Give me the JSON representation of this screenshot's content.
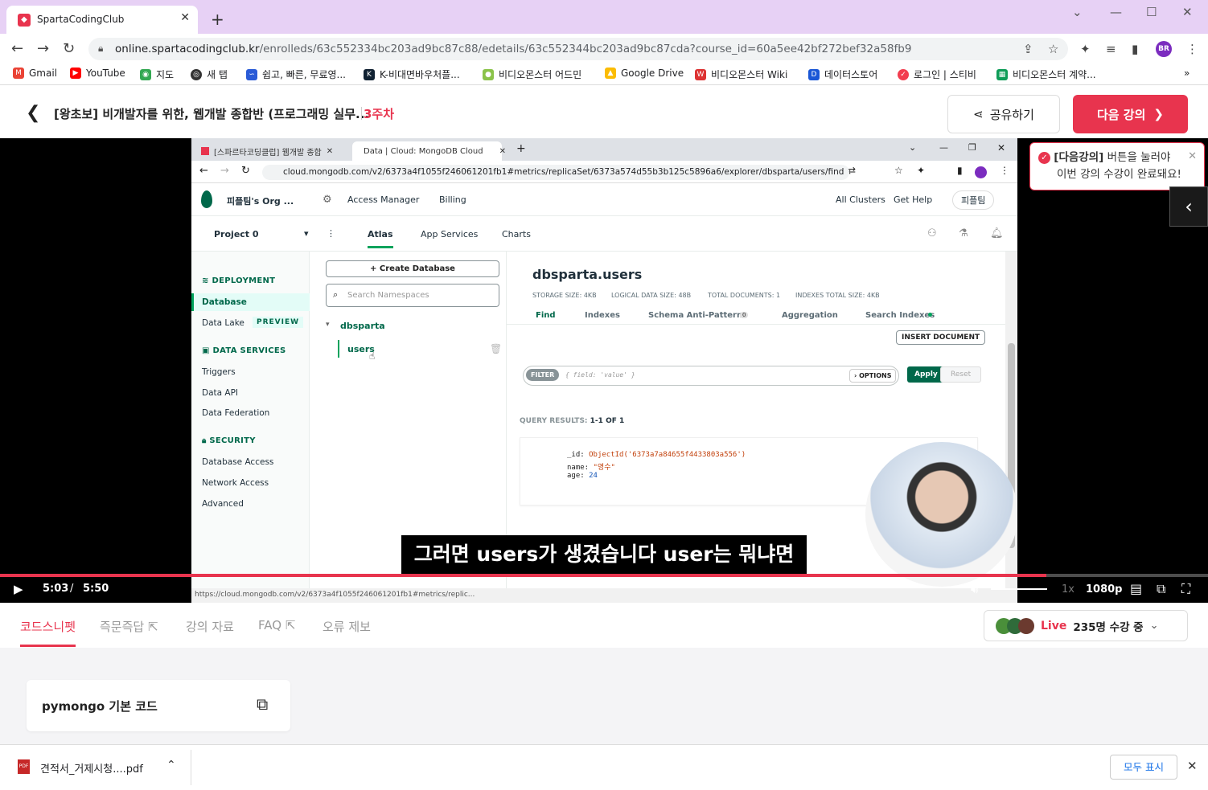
{
  "browser": {
    "tab_title": "SpartaCodingClub",
    "url_host": "online.spartacodingclub.kr",
    "url_path": "/enrolleds/63c552334bc203ad9bc87c88/edetails/63c552344bc203ad9bc87cda?course_id=60a5ee42bf272bef32a58fb9",
    "avatar": "BR",
    "bookmarks": [
      "Gmail",
      "YouTube",
      "지도",
      "새 탭",
      "쉽고, 빠른, 무료영...",
      "K-비대면바우처플...",
      "비디오몬스터 어드민",
      "Google Drive",
      "비디오몬스터 Wiki",
      "데이터스토어",
      "로그인 | 스티비",
      "비디오몬스터 계약..."
    ]
  },
  "header": {
    "course_title": "[왕초보] 비개발자를 위한, 웹개발 종합반 (프로그래밍 실무...",
    "week": "3주차",
    "share_label": "공유하기",
    "next_label": "다음 강의"
  },
  "tooltip": {
    "line1_bold": "[다음강의]",
    "line1_rest": " 버튼을 눌러야",
    "line2": "이번 강의 수강이 완료돼요!"
  },
  "video": {
    "inner_tabs": [
      "[스파르타코딩클럽] 웹개발 종합",
      "Data | Cloud: MongoDB Cloud"
    ],
    "inner_url": "cloud.mongodb.com/v2/6373a4f1055f246061201fb1#metrics/replicaSet/6373a574d55b3b125c5896a6/explorer/dbsparta/users/find",
    "atlas": {
      "org": "피플팀's Org ...",
      "access_manager": "Access Manager",
      "billing": "Billing",
      "all_clusters": "All Clusters",
      "get_help": "Get Help",
      "user": "피플팀",
      "project": "Project 0",
      "tabs": [
        "Atlas",
        "App Services",
        "Charts"
      ],
      "sidebar": {
        "deployment": "DEPLOYMENT",
        "database": "Database",
        "data_lake": "Data Lake",
        "preview": "PREVIEW",
        "data_services": "DATA SERVICES",
        "triggers": "Triggers",
        "data_api": "Data API",
        "data_federation": "Data Federation",
        "security": "SECURITY",
        "database_access": "Database Access",
        "network_access": "Network Access",
        "advanced": "Advanced"
      },
      "create_db": "+ Create Database",
      "search_placeholder": "Search Namespaces",
      "db_name": "dbsparta",
      "collection": "users",
      "collection_title": "dbsparta.users",
      "stats": [
        "STORAGE SIZE: 4KB",
        "LOGICAL DATA SIZE: 48B",
        "TOTAL DOCUMENTS: 1",
        "INDEXES TOTAL SIZE: 4KB"
      ],
      "coll_tabs": [
        "Find",
        "Indexes",
        "Schema Anti-Patterns",
        "Aggregation",
        "Search Indexes"
      ],
      "anti_count": "0",
      "insert_doc": "INSERT DOCUMENT",
      "filter_label": "FILTER",
      "filter_placeholder": "{ field: 'value' }",
      "options": "OPTIONS",
      "apply": "Apply",
      "reset": "Reset",
      "query_results_label": "QUERY RESULTS:",
      "query_results_count": "1-1 OF 1",
      "doc": {
        "id_key": "_id:",
        "id_val": "ObjectId('6373a7a84655f4433803a556')",
        "name_key": "name:",
        "name_val": "\"영수\"",
        "age_key": "age:",
        "age_val": "24"
      }
    },
    "subtitle": "그러면 users가 생겼습니다 user는 뭐냐면",
    "current_time": "5:03",
    "separator": "/",
    "duration": "5:50",
    "progress": 0.866,
    "speed": "1x",
    "quality": "1080p",
    "status_url": "https://cloud.mongodb.com/v2/6373a4f1055f246061201fb1#metrics/replic..."
  },
  "lower_tabs": [
    "코드스니펫",
    "즉문즉답",
    "강의 자료",
    "FAQ",
    "오류 제보"
  ],
  "live": {
    "label": "Live",
    "viewers": "235명 수강 중"
  },
  "snippet": {
    "title": "pymongo 기본 코드"
  },
  "download": {
    "file": "견적서_거제시청....pdf",
    "show_all": "모두 표시"
  },
  "colors": {
    "brand": "#e8344e",
    "atlas_green": "#00684a"
  }
}
